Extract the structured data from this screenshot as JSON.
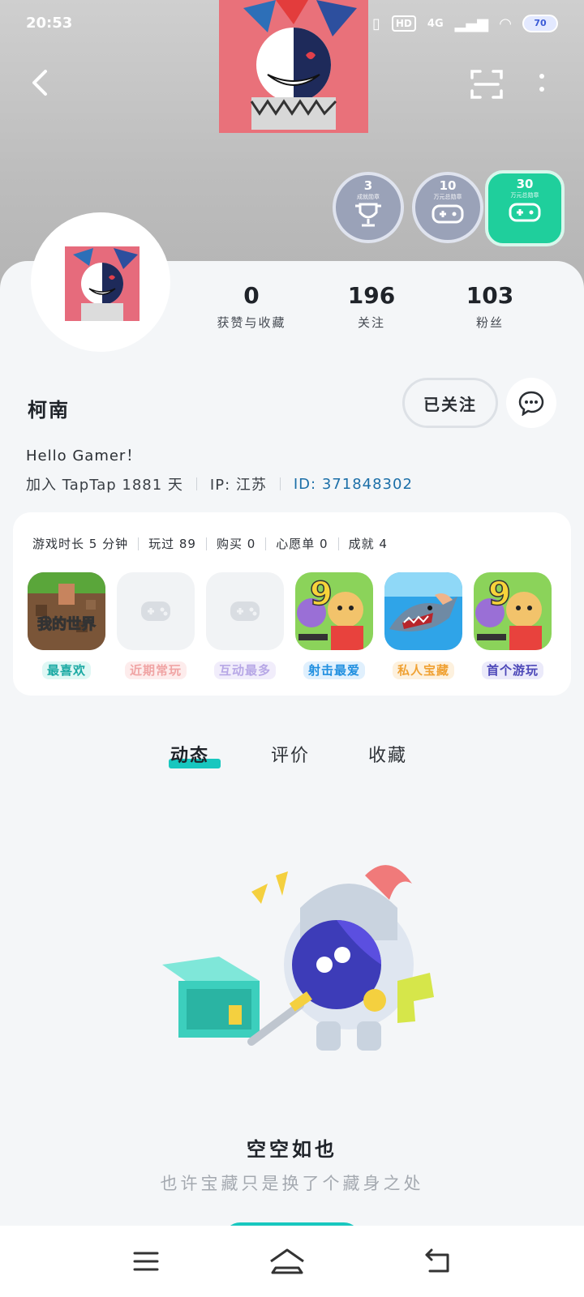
{
  "status_bar": {
    "time": "20:53",
    "hd": "HD",
    "network": "4G",
    "battery": "70"
  },
  "header": {
    "badges": [
      {
        "number": "3",
        "caption": "成就勋章"
      },
      {
        "number": "10",
        "caption": "万元总勋章"
      },
      {
        "number": "30",
        "caption": "万元总勋章"
      }
    ]
  },
  "profile": {
    "stats": [
      {
        "value": "0",
        "label": "获赞与收藏"
      },
      {
        "value": "196",
        "label": "关注"
      },
      {
        "value": "103",
        "label": "粉丝"
      }
    ],
    "name": "柯南",
    "follow_label": "已关注",
    "bio": "Hello Gamer！",
    "join": "加入 TapTap 1881 天",
    "ip": "IP: 江苏",
    "id_label": "ID:",
    "id_value": "371848302"
  },
  "games": {
    "stats": [
      "游戏时长 5 分钟",
      "玩过 89",
      "购买 0",
      "心愿单 0",
      "成就 4"
    ],
    "items": [
      {
        "label": "最喜欢",
        "color": "#1aa9a3",
        "bg": "#dff7f4"
      },
      {
        "label": "近期常玩",
        "color": "#f0a4a4",
        "bg": "#fdecec"
      },
      {
        "label": "互动最多",
        "color": "#b7a7e6",
        "bg": "#f1edfb"
      },
      {
        "label": "射击最爱",
        "color": "#1f8fe0",
        "bg": "#e0f0fd"
      },
      {
        "label": "私人宝藏",
        "color": "#f0a234",
        "bg": "#fdf1de"
      },
      {
        "label": "首个游玩",
        "color": "#4c47b8",
        "bg": "#ebeafa"
      }
    ],
    "minecraft_text": "我的世界"
  },
  "tabs": [
    "动态",
    "评价",
    "收藏"
  ],
  "empty": {
    "title": "空空如也",
    "subtitle": "也许宝藏只是换了个藏身之处"
  },
  "icons": {
    "back": "back-arrow-icon",
    "scan": "scan-icon",
    "more": "more-vertical-icon",
    "message": "chat-bubble-icon",
    "nav_menu": "menu-icon",
    "nav_home": "home-icon",
    "nav_back": "return-icon"
  }
}
